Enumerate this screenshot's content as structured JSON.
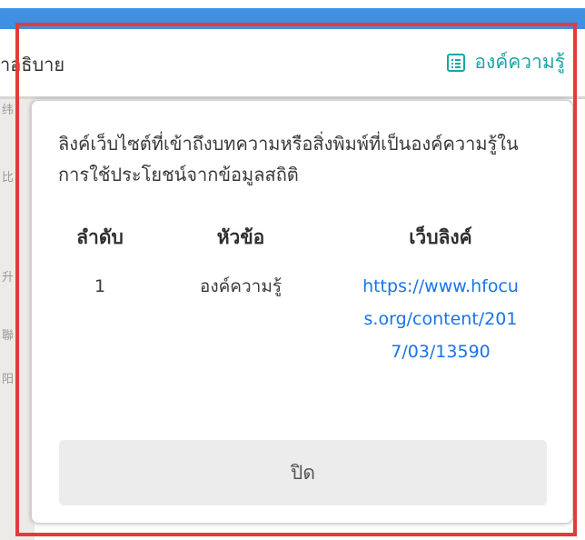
{
  "header": {
    "partial_text": "าอธิบาย",
    "knowledge_link": {
      "label": "องค์ความรู้",
      "icon": "list-icon"
    }
  },
  "map": {
    "fragments": [
      "纬",
      "比",
      "升",
      "聯",
      "阳"
    ]
  },
  "modal": {
    "description": "ลิงค์เว็บไซต์ที่เข้าถึงบทความหรือสิ่งพิมพ์ที่เป็นองค์ความรู้ในการใช้ประโยชน์จากข้อมูลสถิติ",
    "table": {
      "columns": [
        "ลำดับ",
        "หัวข้อ",
        "เว็บลิงค์"
      ],
      "rows": [
        {
          "no": "1",
          "topic": "องค์ความรู้",
          "url": "https://www.hfocus.org/content/2017/03/13590"
        }
      ]
    },
    "close_label": "ปิด"
  },
  "colors": {
    "accent_teal": "#18a6a6",
    "link_blue": "#1a73e8",
    "top_bar_blue": "#3f8fe3",
    "highlight_red": "#e23b3b"
  }
}
